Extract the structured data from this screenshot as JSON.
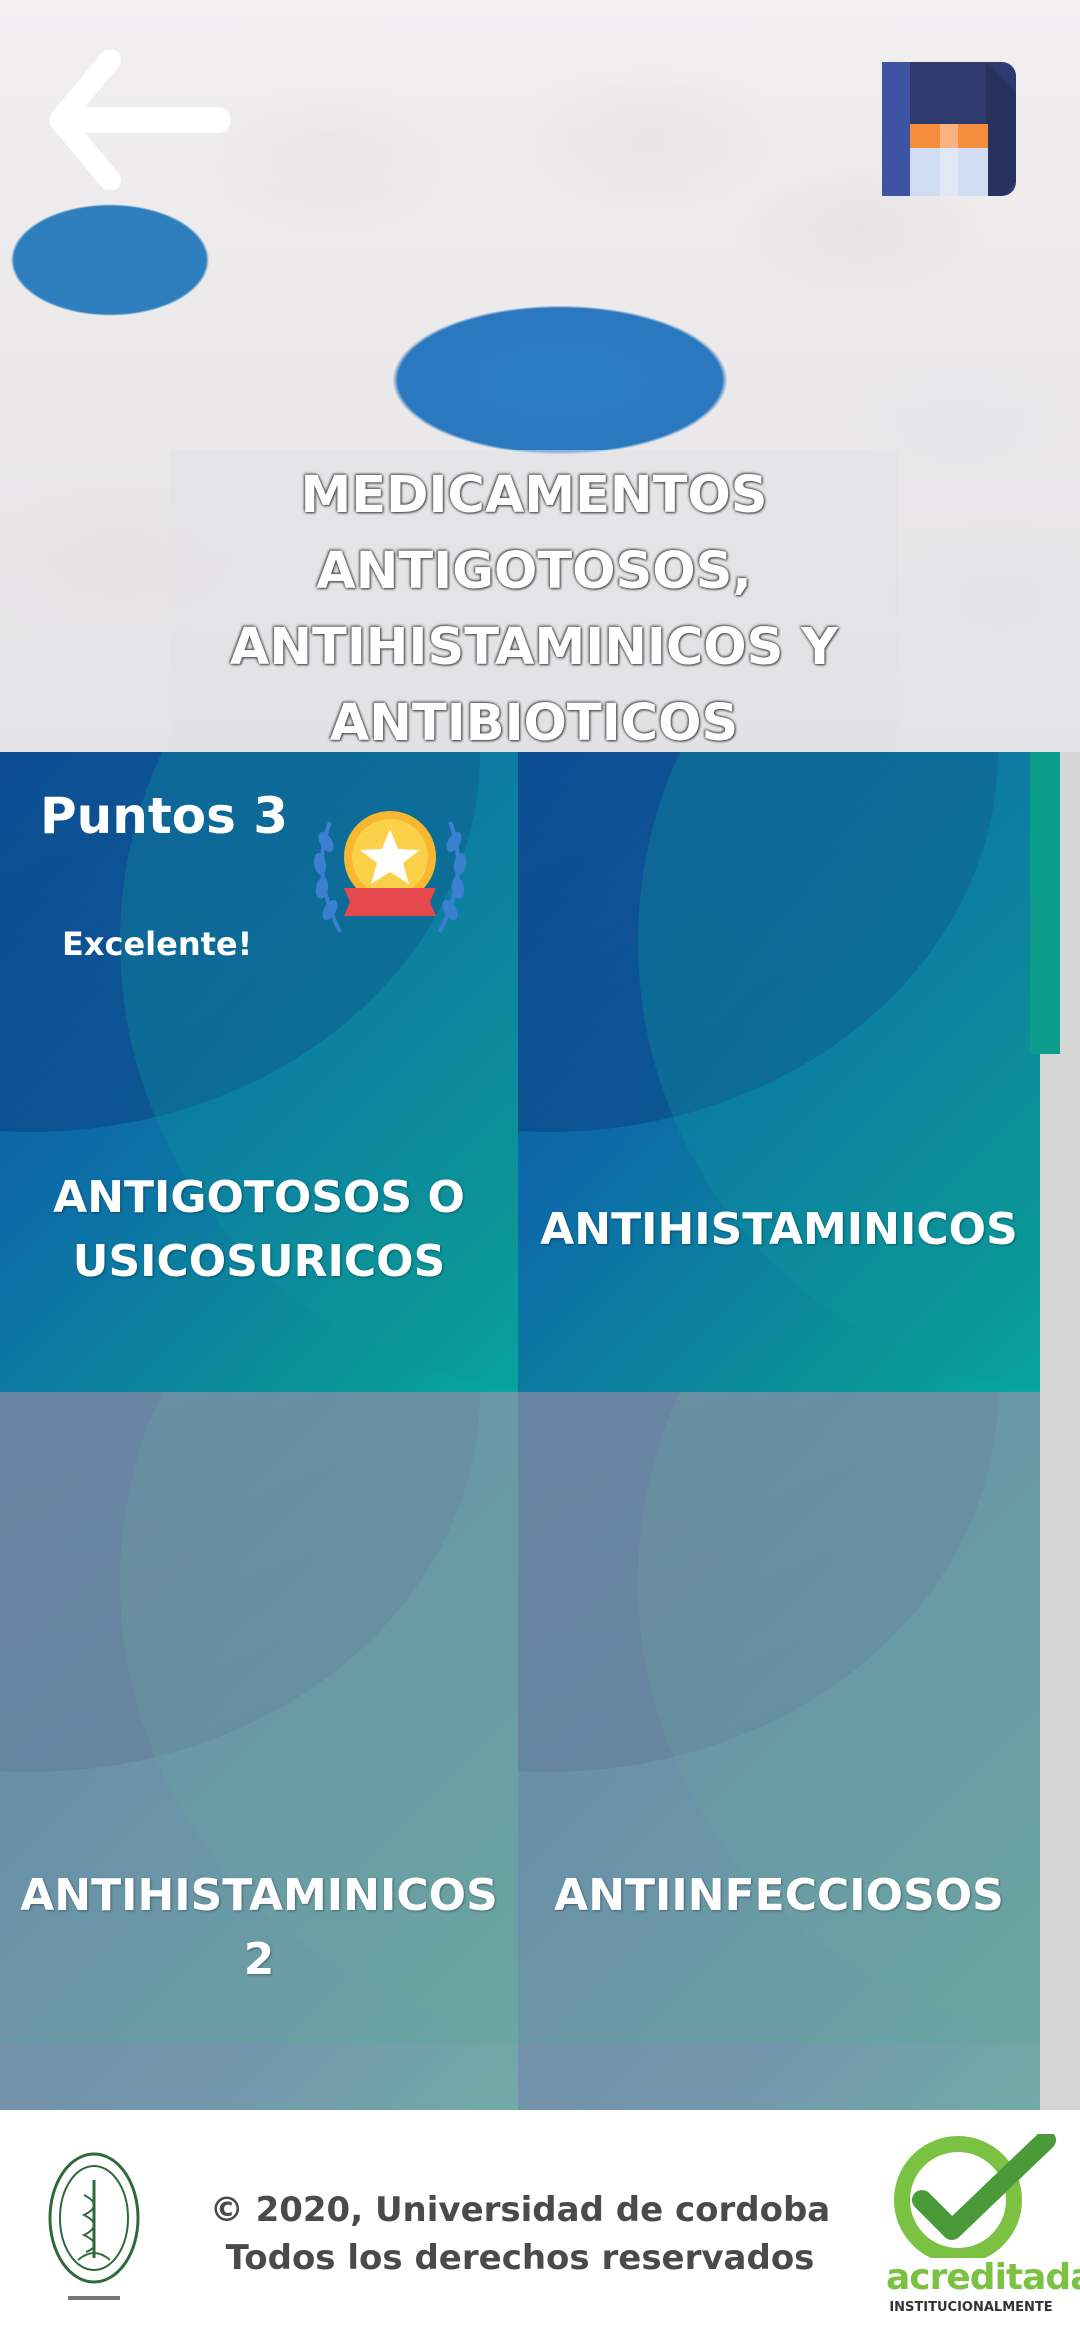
{
  "header": {
    "title_lines": [
      "MEDICAMENTOS",
      "ANTIGOTOSOS,",
      "ANTIHISTAMINICOS Y",
      "ANTIBIOTICOS"
    ],
    "back_icon": "arrow-left-icon",
    "save_icon": "floppy-disk-icon"
  },
  "score": {
    "points_label": "Puntos 3",
    "rating": "Excelente!",
    "medal_icon": "medal-star-icon"
  },
  "tiles": [
    {
      "label_lines": [
        "ANTIGOTOSOS O",
        "USICOSURICOS"
      ],
      "state": "unlocked"
    },
    {
      "label_lines": [
        "ANTIHISTAMINICOS"
      ],
      "state": "unlocked"
    },
    {
      "label_lines": [
        "ANTIHISTAMINICOS 2"
      ],
      "state": "locked"
    },
    {
      "label_lines": [
        "ANTIINFECCIOSOS"
      ],
      "state": "locked"
    }
  ],
  "footer": {
    "line1": "© 2020, Universidad de cordoba",
    "line2": "Todos los derechos reservados",
    "accreditation_word": "acreditada",
    "accreditation_sub": "INSTITUCIONALMENTE"
  },
  "colors": {
    "tile_active_start": "#0d4f9a",
    "tile_active_end": "#06a8a0",
    "tile_locked": "#6a92a8",
    "scroll_thumb": "#0b9c8a",
    "accent_green": "#7cc242"
  }
}
